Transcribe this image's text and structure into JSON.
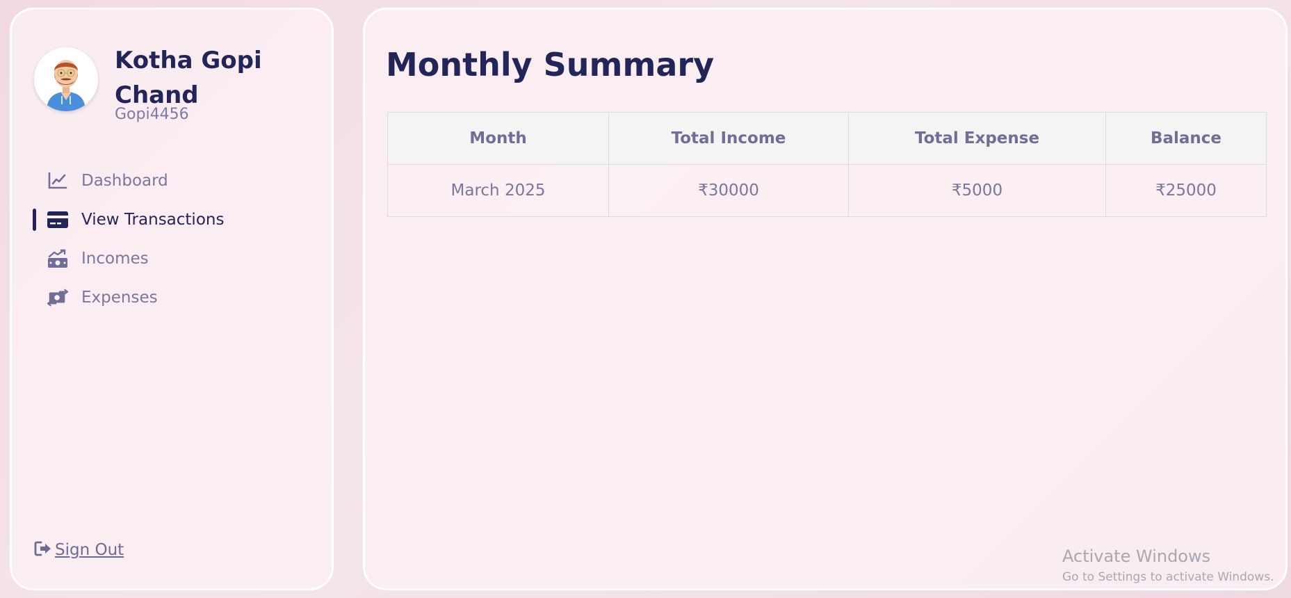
{
  "user": {
    "name": "Kotha Gopi Chand",
    "handle": "Gopi4456",
    "avatar_icon": "avatar-illustration"
  },
  "sidebar": {
    "items": [
      {
        "label": "Dashboard",
        "icon": "line-chart-icon",
        "active": false
      },
      {
        "label": "View Transactions",
        "icon": "credit-card-icon",
        "active": true
      },
      {
        "label": "Incomes",
        "icon": "money-growth-icon",
        "active": false
      },
      {
        "label": "Expenses",
        "icon": "money-exchange-icon",
        "active": false
      }
    ],
    "signout_label": " Sign Out"
  },
  "main": {
    "title": "Monthly Summary",
    "table": {
      "headers": [
        "Month",
        "Total Income",
        "Total Expense",
        "Balance"
      ],
      "rows": [
        [
          "March 2025",
          "₹30000",
          "₹5000",
          "₹25000"
        ]
      ]
    }
  },
  "watermark": {
    "title": "Activate Windows",
    "subtitle": "Go to Settings to activate Windows."
  },
  "colors": {
    "primary": "#232559",
    "muted": "#78779d",
    "panel": "#fbf0f4",
    "border": "#ffffff"
  }
}
